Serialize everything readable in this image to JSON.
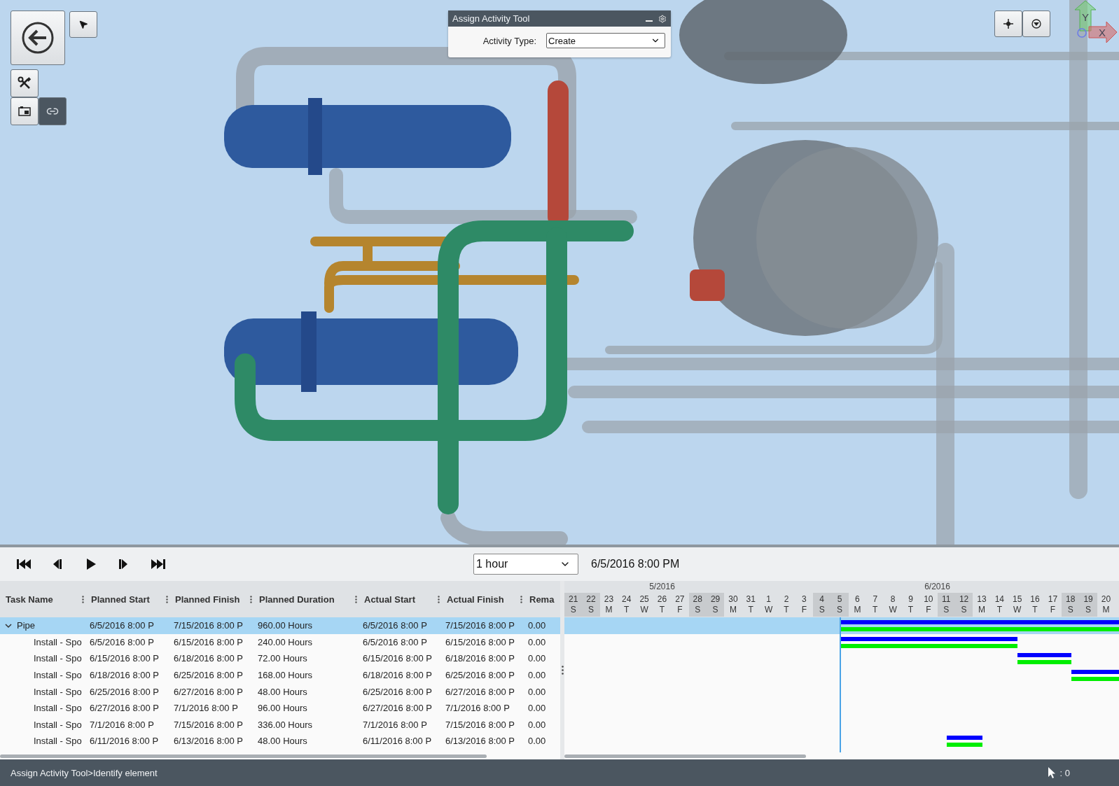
{
  "viewport": {
    "activity_tool": {
      "title": "Assign Activity Tool",
      "label": "Activity Type:",
      "value": "Create"
    },
    "axes": [
      "Y",
      "X"
    ]
  },
  "playback": {
    "interval": "1 hour",
    "current_time": "6/5/2016 8:00 PM"
  },
  "table": {
    "columns": [
      "Task Name",
      "Planned Start",
      "Planned Finish",
      "Planned Duration",
      "Actual Start",
      "Actual Finish",
      "Rema"
    ],
    "rows": [
      {
        "cells": [
          "Pipe",
          "6/5/2016 8:00 P",
          "7/15/2016 8:00 P",
          "960.00 Hours",
          "6/5/2016 8:00 P",
          "7/15/2016 8:00 P",
          "0.00"
        ],
        "expanded": true,
        "selected": true,
        "children": [
          {
            "cells": [
              "Install - Spo",
              "6/5/2016 8:00 P",
              "6/15/2016 8:00 P",
              "240.00 Hours",
              "6/5/2016 8:00 P",
              "6/15/2016 8:00 P",
              "0.00"
            ],
            "selected": false
          },
          {
            "cells": [
              "Install - Spo",
              "6/15/2016 8:00 P",
              "6/18/2016 8:00 P",
              "72.00 Hours",
              "6/15/2016 8:00 P",
              "6/18/2016 8:00 P",
              "0.00"
            ],
            "selected": false
          },
          {
            "cells": [
              "Install - Spo",
              "6/18/2016 8:00 P",
              "6/25/2016 8:00 P",
              "168.00 Hours",
              "6/18/2016 8:00 P",
              "6/25/2016 8:00 P",
              "0.00"
            ],
            "selected": false
          },
          {
            "cells": [
              "Install - Spo",
              "6/25/2016 8:00 P",
              "6/27/2016 8:00 P",
              "48.00 Hours",
              "6/25/2016 8:00 P",
              "6/27/2016 8:00 P",
              "0.00"
            ],
            "selected": false
          },
          {
            "cells": [
              "Install - Spo",
              "6/27/2016 8:00 P",
              "7/1/2016 8:00 P",
              "96.00 Hours",
              "6/27/2016 8:00 P",
              "7/1/2016 8:00 P",
              "0.00"
            ],
            "selected": false
          },
          {
            "cells": [
              "Install - Spo",
              "7/1/2016 8:00 P",
              "7/15/2016 8:00 P",
              "336.00 Hours",
              "7/1/2016 8:00 P",
              "7/15/2016 8:00 P",
              "0.00"
            ],
            "selected": false
          },
          {
            "cells": [
              "Install - Spo",
              "6/11/2016 8:00 P",
              "6/13/2016 8:00 P",
              "48.00 Hours",
              "6/11/2016 8:00 P",
              "6/13/2016 8:00 P",
              "0.00"
            ],
            "selected": false
          }
        ]
      }
    ]
  },
  "gantt": {
    "months": [
      {
        "label": "5/2016",
        "days": [
          {
            "day": "21",
            "weekday": "S",
            "weekend": true
          },
          {
            "day": "22",
            "weekday": "S",
            "weekend": true
          },
          {
            "day": "23",
            "weekday": "M",
            "weekend": false
          },
          {
            "day": "24",
            "weekday": "T",
            "weekend": false
          },
          {
            "day": "25",
            "weekday": "W",
            "weekend": false
          },
          {
            "day": "26",
            "weekday": "T",
            "weekend": false
          },
          {
            "day": "27",
            "weekday": "F",
            "weekend": false
          },
          {
            "day": "28",
            "weekday": "S",
            "weekend": true
          },
          {
            "day": "29",
            "weekday": "S",
            "weekend": true
          },
          {
            "day": "30",
            "weekday": "M",
            "weekend": false
          },
          {
            "day": "31",
            "weekday": "T",
            "weekend": false
          }
        ]
      },
      {
        "label": "6/2016",
        "days": [
          {
            "day": "1",
            "weekday": "W",
            "weekend": false
          },
          {
            "day": "2",
            "weekday": "T",
            "weekend": false
          },
          {
            "day": "3",
            "weekday": "F",
            "weekend": false
          },
          {
            "day": "4",
            "weekday": "S",
            "weekend": true
          },
          {
            "day": "5",
            "weekday": "S",
            "weekend": true
          },
          {
            "day": "6",
            "weekday": "M",
            "weekend": false
          },
          {
            "day": "7",
            "weekday": "T",
            "weekend": false
          },
          {
            "day": "8",
            "weekday": "W",
            "weekend": false
          },
          {
            "day": "9",
            "weekday": "T",
            "weekend": false
          },
          {
            "day": "10",
            "weekday": "F",
            "weekend": false
          },
          {
            "day": "11",
            "weekday": "S",
            "weekend": true
          },
          {
            "day": "12",
            "weekday": "S",
            "weekend": true
          },
          {
            "day": "13",
            "weekday": "M",
            "weekend": false
          },
          {
            "day": "14",
            "weekday": "T",
            "weekend": false
          },
          {
            "day": "15",
            "weekday": "W",
            "weekend": false
          },
          {
            "day": "16",
            "weekday": "T",
            "weekend": false
          },
          {
            "day": "17",
            "weekday": "F",
            "weekend": false
          },
          {
            "day": "18",
            "weekday": "S",
            "weekend": true
          },
          {
            "day": "19",
            "weekday": "S",
            "weekend": true
          },
          {
            "day": "20",
            "weekday": "M",
            "weekend": false
          }
        ]
      }
    ]
  },
  "status_bar": {
    "text": "Assign Activity Tool>Identify element",
    "count": ": 0"
  }
}
